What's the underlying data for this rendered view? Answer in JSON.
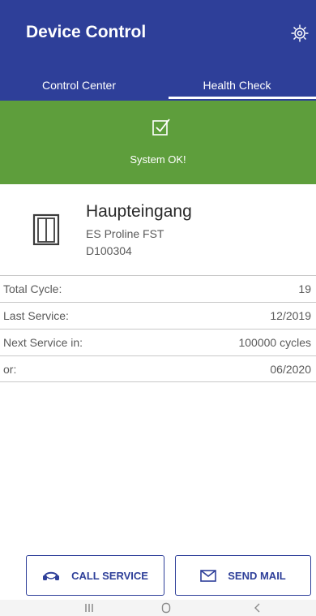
{
  "header": {
    "title": "Device Control",
    "settings_icon": "gear-icon",
    "background": "#2e3f99"
  },
  "tabs": [
    {
      "label": "Control Center",
      "selected": false
    },
    {
      "label": "Health Check",
      "selected": true
    }
  ],
  "status": {
    "icon": "checkbox-checked-icon",
    "text": "System OK!",
    "color": "#5e9e3c"
  },
  "device": {
    "icon": "door-icon",
    "name": "Haupteingang",
    "model": "ES Proline FST",
    "serial": "D100304"
  },
  "info_rows": [
    {
      "label": "Total Cycle:",
      "value": "19"
    },
    {
      "label": "Last Service:",
      "value": "12/2019"
    },
    {
      "label": "Next Service in:",
      "value": "100000 cycles"
    },
    {
      "label": "or:",
      "value": "06/2020"
    }
  ],
  "actions": {
    "call_service": {
      "label": "CALL SERVICE",
      "icon": "headset-icon"
    },
    "send_mail": {
      "label": "SEND MAIL",
      "icon": "mail-icon"
    }
  },
  "system_nav": {
    "recents_icon": "recents-icon",
    "home_icon": "home-icon",
    "back_icon": "back-icon"
  }
}
